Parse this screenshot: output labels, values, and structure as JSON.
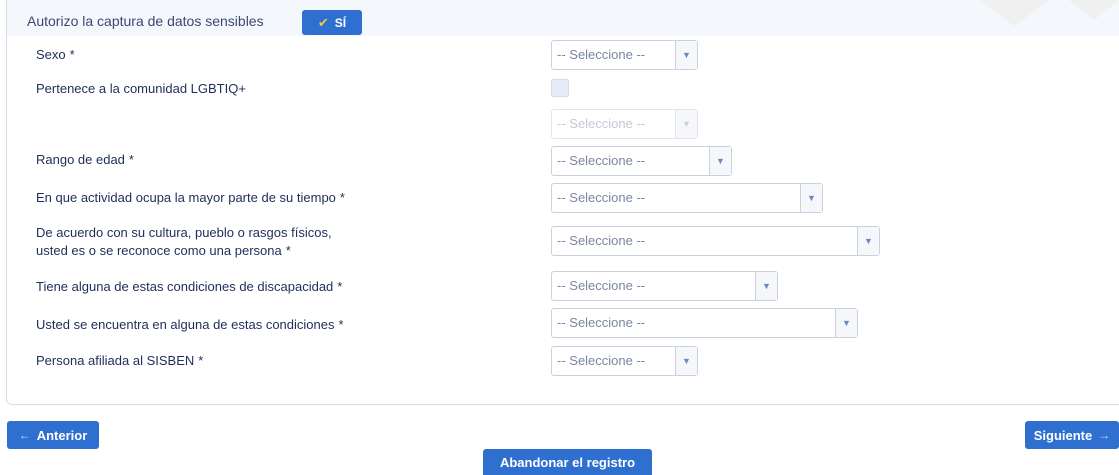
{
  "consent": {
    "label": "Autorizo la captura de datos sensibles",
    "toggle_label": "SÍ",
    "toggle_on": true
  },
  "fields": [
    {
      "label": "Sexo",
      "required": "*",
      "value": "-- Seleccione --"
    },
    {
      "label": "Pertenece a la comunidad LGBTIQ+",
      "required": "",
      "checked": false
    },
    {
      "label": "",
      "value": "-- Seleccione --",
      "disabled": true
    },
    {
      "label": "Rango de edad",
      "required": "*",
      "value": "-- Seleccione --"
    },
    {
      "label": "En que actividad ocupa la mayor parte de su tiempo",
      "required": "*",
      "value": "-- Seleccione --"
    },
    {
      "label_line1": "De acuerdo con su cultura, pueblo o rasgos físicos,",
      "label_line2": "usted es o se reconoce como una persona",
      "required": "*",
      "value": "-- Seleccione --"
    },
    {
      "label": "Tiene alguna de estas condiciones de discapacidad",
      "required": "*",
      "value": "-- Seleccione --"
    },
    {
      "label": "Usted se encuentra en alguna de estas condiciones",
      "required": "*",
      "value": "-- Seleccione --"
    },
    {
      "label": "Persona afiliada al SISBEN",
      "required": "*",
      "value": "-- Seleccione --"
    }
  ],
  "nav": {
    "prev_label": "Anterior",
    "next_label": "Siguiente",
    "abandon_label": "Abandonar el registro"
  },
  "icons": {
    "check": "check-icon",
    "dropdown": "chevron-down-icon",
    "left": "arrow-left-icon",
    "right": "arrow-right-icon"
  },
  "colors": {
    "primary": "#2f6fcf",
    "text": "#1f2d5a",
    "border": "#c9d1de"
  }
}
